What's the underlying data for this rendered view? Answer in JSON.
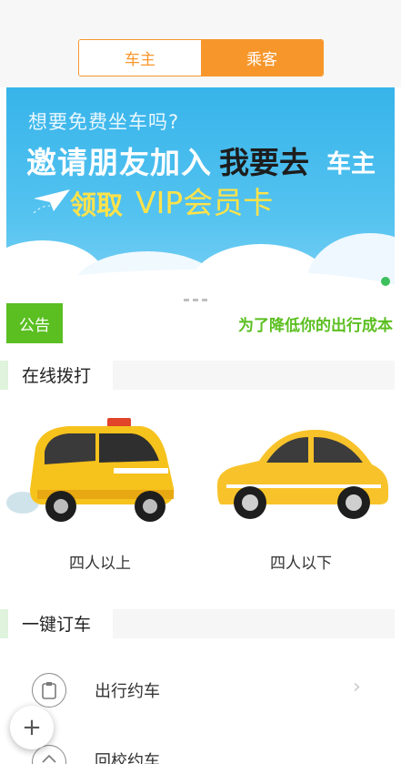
{
  "tabs": {
    "driver": "车主",
    "passenger": "乘客"
  },
  "banner": {
    "subtitle": "想要免费坐车吗?",
    "line1": "邀请朋友加入",
    "line1_dest": "我要去",
    "line1_role": "车主",
    "line2_get": "领取",
    "line2_vip": "VIP会员卡"
  },
  "notice": {
    "tag": "公告",
    "text": "为了降低你的出行成本"
  },
  "online_call": {
    "title": "在线拨打",
    "options": [
      {
        "label": "四人以上",
        "icon": "minibus-taxi-icon"
      },
      {
        "label": "四人以下",
        "icon": "yellow-car-icon"
      }
    ]
  },
  "one_click": {
    "title": "一键订车",
    "items": [
      {
        "label": "出行约车",
        "icon": "clipboard-icon"
      },
      {
        "label": "回校约车",
        "icon": "school-icon"
      }
    ]
  },
  "fab": {
    "label": "+"
  },
  "colors": {
    "accent": "#f7962b",
    "green": "#5bbf21",
    "banner": "#37b4ea"
  }
}
